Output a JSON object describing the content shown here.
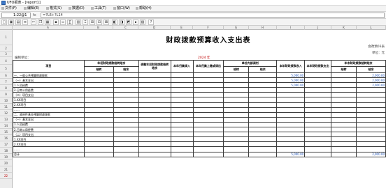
{
  "window": {
    "title": "UFO报表 - [report1]"
  },
  "menu": [
    "文件(F)",
    "编辑(E)",
    "格式(S)",
    "数据(D)",
    "工具(T)",
    "窗口(W)",
    "帮助(H)"
  ],
  "formula_bar": {
    "cell_ref": "1:22@1",
    "separator": "fx",
    "formula": "=?L6+?L14"
  },
  "toolbar": [
    "□",
    "▣",
    "▤",
    "≡",
    "✂",
    "❐",
    "▦",
    "▪",
    "▫",
    "∑",
    "▥",
    "⌶",
    "⊞",
    "⊟",
    "⊠",
    "◧",
    "◨",
    "◩",
    "∎",
    "▧",
    "?"
  ],
  "columns": [
    "A",
    "B",
    "C",
    "D",
    "E",
    "F",
    "G",
    "H",
    "I",
    "J",
    "K",
    "L"
  ],
  "rows": [
    "1",
    "2",
    "3",
    "4",
    "5",
    "6",
    "7",
    "8",
    "9",
    "10",
    "11",
    "12",
    "13",
    "14",
    "15",
    "16",
    "17",
    "18",
    "19",
    "20",
    "21",
    "22"
  ],
  "report": {
    "title": "财政拨款预算收入支出表",
    "form_code": "会政预03表",
    "unit": "单位：元",
    "org": "编制单位：",
    "year": "2024 年",
    "header": {
      "item": "项目",
      "beginning_balance": "年初财政拨款结转结余",
      "carry": "结转",
      "surplus": "结余",
      "adjust": "调整年初财政拨款结转结余",
      "transfer_in": "本年归集调入",
      "transfer_out": "本年归集上缴或调出",
      "internal": "单位内部调剂",
      "income": "本年财政拨款收入",
      "expense": "本年财政拨款支出",
      "ending_balance": "年末财政拨款结转结余"
    },
    "rows": [
      {
        "label": "一、一般公共预算财政拨款",
        "income": "5,000.00",
        "expense": "",
        "end_surplus": "2,000.00"
      },
      {
        "label": "（一）基本支出",
        "income": "5,000.00",
        "expense": "",
        "end_surplus": "2,000.00"
      },
      {
        "label": "1.人员经费",
        "income": "5,000.00",
        "expense": "",
        "end_surplus": "2,000.00"
      },
      {
        "label": "2.日常公用经费",
        "income": "",
        "expense": "",
        "end_surplus": ""
      },
      {
        "label": "（二）项目支出",
        "income": "",
        "expense": "",
        "end_surplus": ""
      },
      {
        "label": "1.XX项目",
        "income": "",
        "expense": "",
        "end_surplus": ""
      },
      {
        "label": "2.XX项目",
        "income": "",
        "expense": "",
        "end_surplus": ""
      },
      {
        "label": "……",
        "income": "",
        "expense": "",
        "end_surplus": ""
      },
      {
        "label": "二、政府性基金预算财政拨款",
        "income": "",
        "expense": "",
        "end_surplus": ""
      },
      {
        "label": "（一）基本支出",
        "income": "",
        "expense": "",
        "end_surplus": ""
      },
      {
        "label": "1.人员经费",
        "income": "",
        "expense": "",
        "end_surplus": ""
      },
      {
        "label": "2.日常公用经费",
        "income": "",
        "expense": "",
        "end_surplus": ""
      },
      {
        "label": "（二）项目支出",
        "income": "",
        "expense": "",
        "end_surplus": ""
      },
      {
        "label": "1.XX项目",
        "income": "",
        "expense": "",
        "end_surplus": ""
      },
      {
        "label": "2.XX项目",
        "income": "",
        "expense": "",
        "end_surplus": ""
      },
      {
        "label": "……",
        "income": "",
        "expense": "",
        "end_surplus": ""
      },
      {
        "label": "总计",
        "income": "5,000.00",
        "expense": "",
        "end_surplus": "2,000.00"
      }
    ]
  }
}
